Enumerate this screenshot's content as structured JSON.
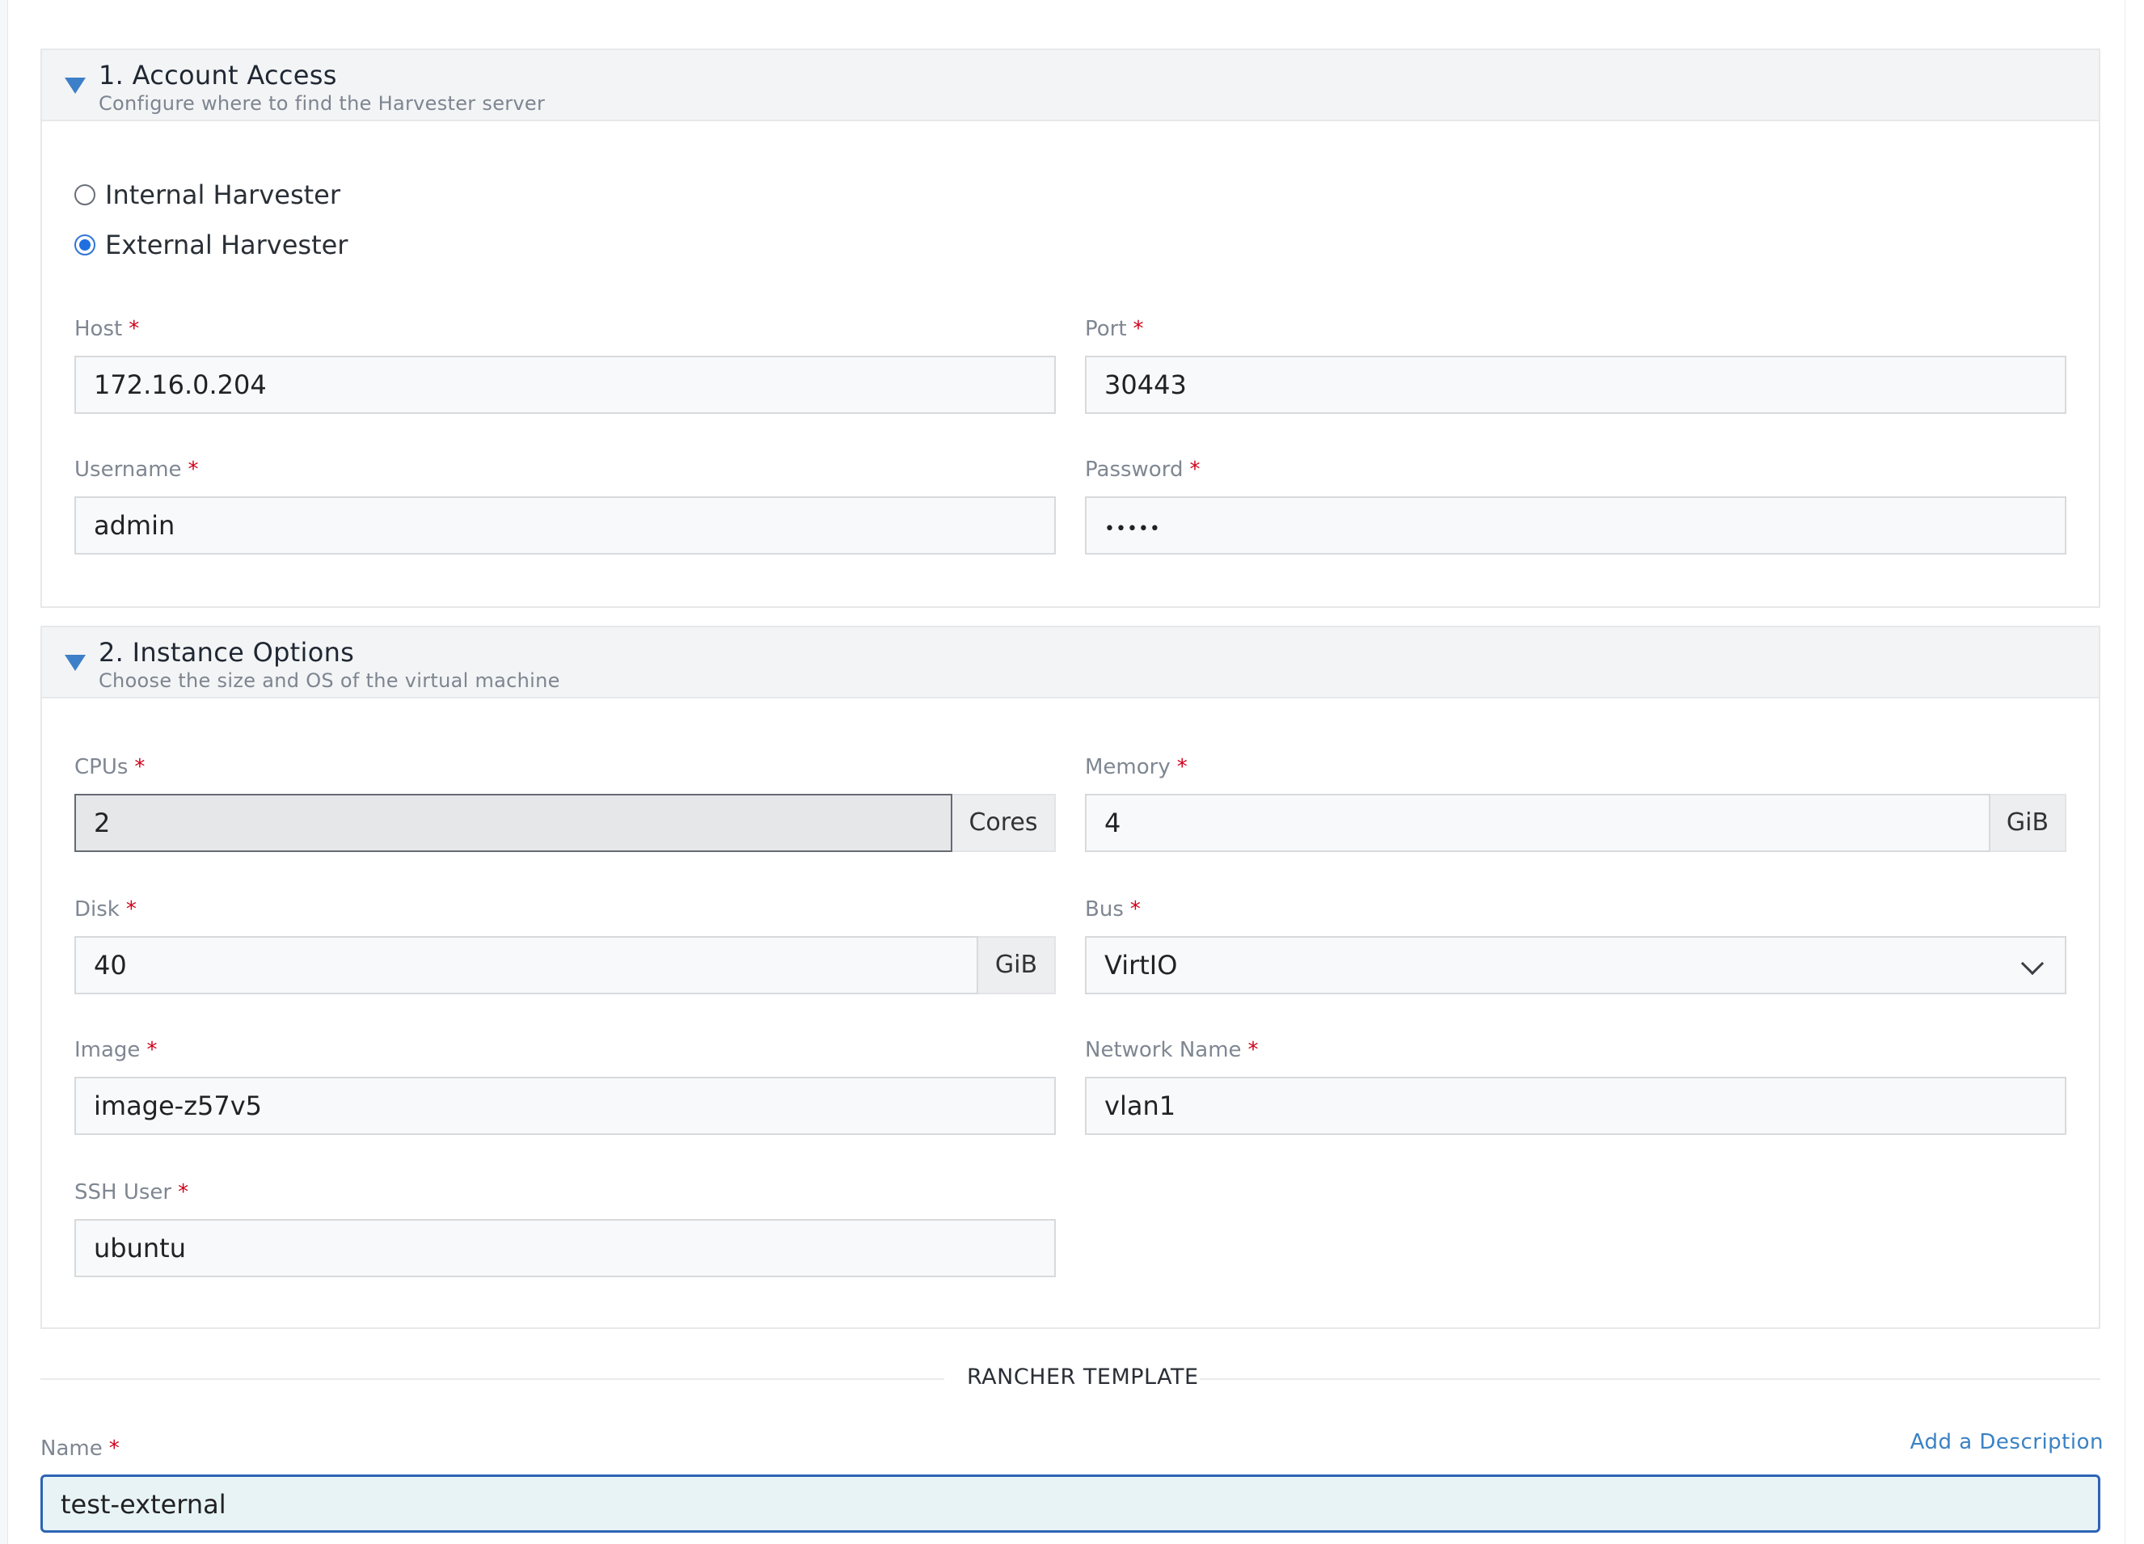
{
  "section1": {
    "title": "1. Account Access",
    "subtitle": "Configure where to find the Harvester server",
    "radios": [
      {
        "label": "Internal Harvester",
        "selected": false
      },
      {
        "label": "External Harvester",
        "selected": true
      }
    ],
    "host": {
      "label": "Host",
      "value": "172.16.0.204"
    },
    "port": {
      "label": "Port",
      "value": "30443"
    },
    "username": {
      "label": "Username",
      "value": "admin"
    },
    "password": {
      "label": "Password",
      "value": "•••••"
    }
  },
  "section2": {
    "title": "2. Instance Options",
    "subtitle": "Choose the size and OS of the virtual machine",
    "cpus": {
      "label": "CPUs",
      "value": "2",
      "unit": "Cores"
    },
    "memory": {
      "label": "Memory",
      "value": "4",
      "unit": "GiB"
    },
    "disk": {
      "label": "Disk",
      "value": "40",
      "unit": "GiB"
    },
    "bus": {
      "label": "Bus",
      "value": "VirtIO"
    },
    "image": {
      "label": "Image",
      "value": "image-z57v5"
    },
    "network": {
      "label": "Network Name",
      "value": "vlan1"
    },
    "ssh_user": {
      "label": "SSH User",
      "value": "ubuntu"
    }
  },
  "template": {
    "heading": "RANCHER TEMPLATE",
    "name": {
      "label": "Name",
      "value": "test-external"
    },
    "add_description": "Add a Description"
  },
  "required_marker": "*"
}
